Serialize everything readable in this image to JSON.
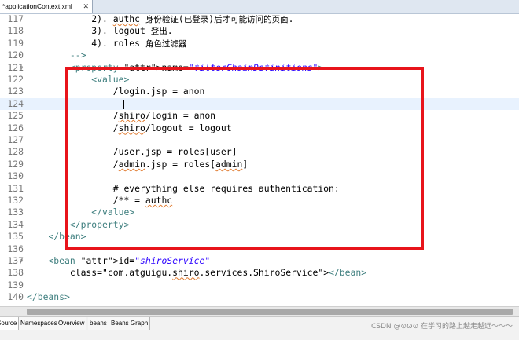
{
  "editor_tab": {
    "title": "*applicationContext.xml",
    "close_glyph": "✕"
  },
  "lines": [
    {
      "num": "117",
      "code": "            2). authc 身份验证(已登录)后才可能访问的页面."
    },
    {
      "num": "118",
      "code": "            3). logout 登出."
    },
    {
      "num": "119",
      "code": "            4). roles 角色过滤器"
    },
    {
      "num": "120",
      "code": "        -->"
    },
    {
      "num": "121",
      "code": "        <property name=\"filterChainDefinitions\">"
    },
    {
      "num": "122",
      "code": "            <value>"
    },
    {
      "num": "123",
      "code": "                /login.jsp = anon"
    },
    {
      "num": "124",
      "code": ""
    },
    {
      "num": "125",
      "code": "                /shiro/login = anon"
    },
    {
      "num": "126",
      "code": "                /shiro/logout = logout"
    },
    {
      "num": "127",
      "code": ""
    },
    {
      "num": "128",
      "code": "                /user.jsp = roles[user]"
    },
    {
      "num": "129",
      "code": "                /admin.jsp = roles[admin]"
    },
    {
      "num": "130",
      "code": ""
    },
    {
      "num": "131",
      "code": "                # everything else requires authentication:"
    },
    {
      "num": "132",
      "code": "                /** = authc"
    },
    {
      "num": "133",
      "code": "            </value>"
    },
    {
      "num": "134",
      "code": "        </property>"
    },
    {
      "num": "135",
      "code": "    </bean>"
    },
    {
      "num": "136",
      "code": ""
    },
    {
      "num": "137",
      "code": "    <bean id=\"shiroService\""
    },
    {
      "num": "138",
      "code": "        class=\"com.atguigu.shiro.services.ShiroService\"></bean>"
    },
    {
      "num": "139",
      "code": ""
    },
    {
      "num": "140",
      "code": "</beans>"
    }
  ],
  "fold_markers": [
    "121",
    "137"
  ],
  "current_line": "124",
  "bottom_tabs": [
    "Source",
    "Namespaces",
    "Overview",
    "beans",
    "Beans Graph"
  ],
  "active_bottom_tab": "Source",
  "watermark": "CSDN @⊙ω⊙ 在学习的路上越走越远～～～",
  "colors": {
    "tag": "#3f7f7f",
    "attribute": "#7f007f",
    "string": "#2a00ff",
    "highlight_box": "#e8141b",
    "current_line": "#e8f2fe"
  }
}
